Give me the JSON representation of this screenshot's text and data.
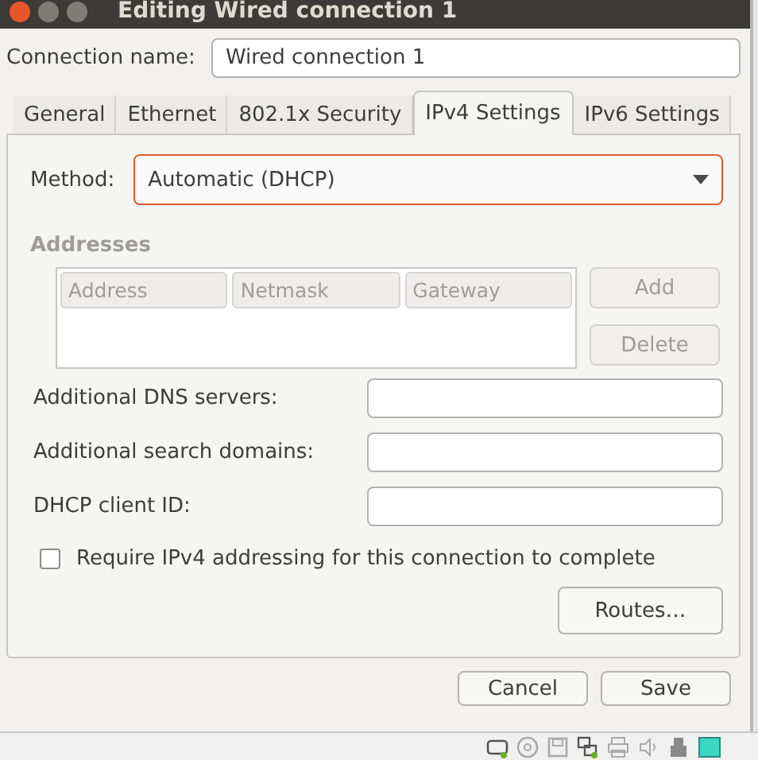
{
  "window": {
    "title": "Editing Wired connection 1"
  },
  "connection_name": {
    "label": "Connection name:",
    "value": "Wired connection 1"
  },
  "tabs": [
    {
      "label": "General",
      "selected": false
    },
    {
      "label": "Ethernet",
      "selected": false
    },
    {
      "label": "802.1x Security",
      "selected": false
    },
    {
      "label": "IPv4 Settings",
      "selected": true
    },
    {
      "label": "IPv6 Settings",
      "selected": false
    }
  ],
  "method": {
    "label": "Method:",
    "value": "Automatic (DHCP)"
  },
  "addresses": {
    "heading": "Addresses",
    "disabled": true,
    "columns": [
      "Address",
      "Netmask",
      "Gateway"
    ],
    "buttons": [
      "Add",
      "Delete"
    ]
  },
  "fields": [
    {
      "label": "Additional DNS servers:"
    },
    {
      "label": "Additional search domains:"
    },
    {
      "label": "DHCP client ID:"
    }
  ],
  "require_checkbox": {
    "label": "Require IPv4 addressing for this connection to complete",
    "checked": false
  },
  "routes_button": "Routes…",
  "dialog_buttons": [
    "Cancel",
    "Save"
  ]
}
